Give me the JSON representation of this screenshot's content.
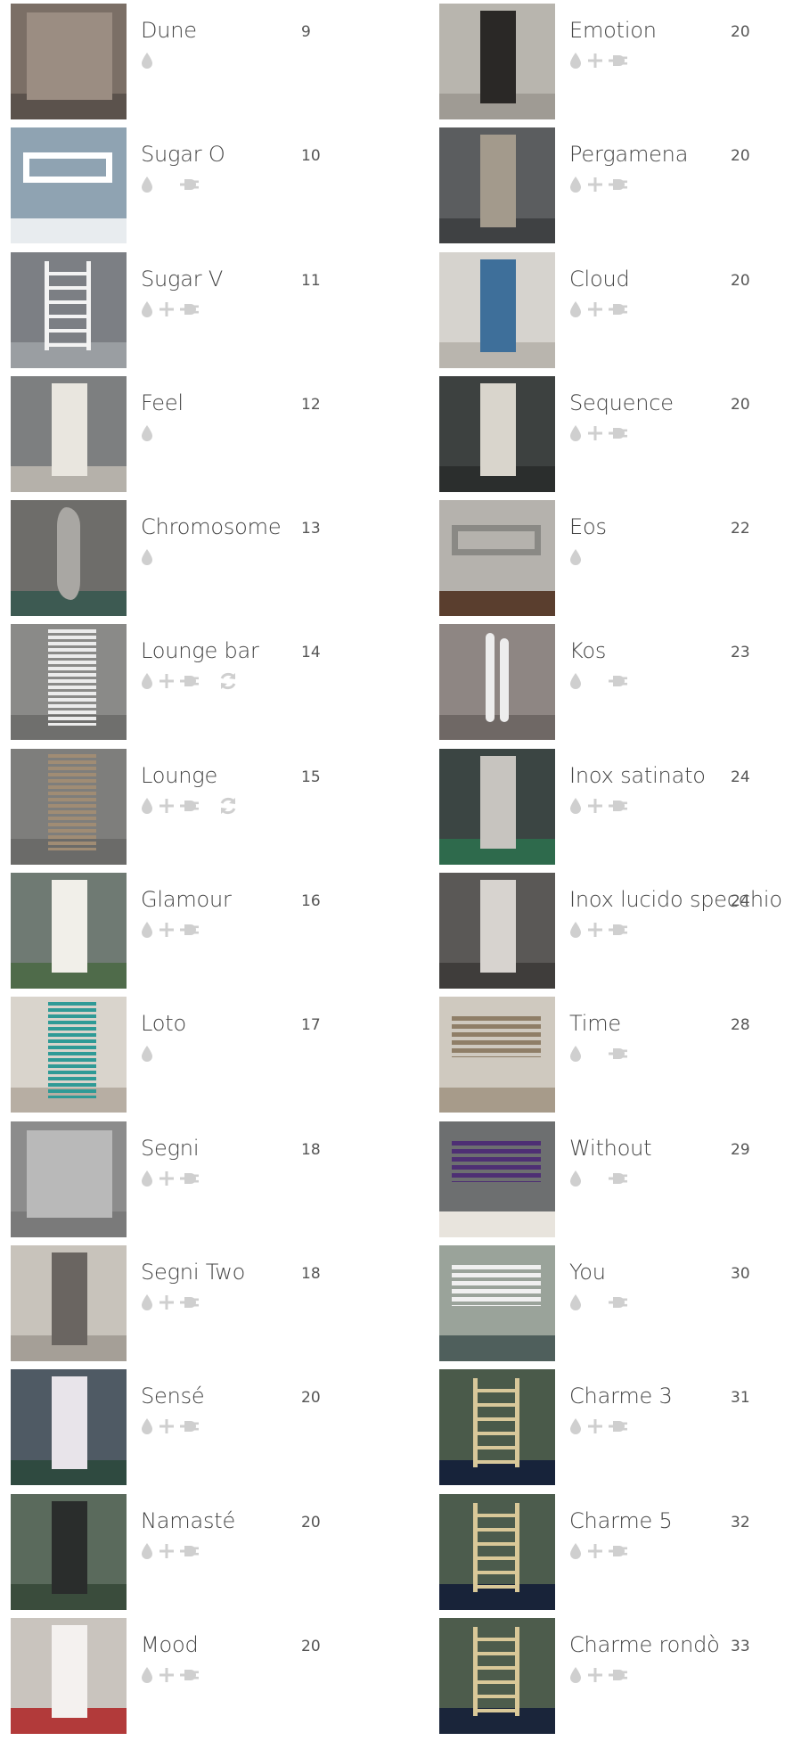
{
  "icon_color": "#cfcfcf",
  "left_column": [
    {
      "name": "Dune",
      "page": "9",
      "icons": [
        "water-drop-icon"
      ],
      "thumb": {
        "wall": "#7b6f66",
        "radiator": "#9b8d82",
        "floor": "#5b524c",
        "shape": "wide-panel"
      }
    },
    {
      "name": "Sugar O",
      "page": "10",
      "icons": [
        "water-drop-icon",
        "electric-plug-icon"
      ],
      "thumb": {
        "wall": "#8fa3b2",
        "radiator": "#ffffff",
        "floor": "#e8ecef",
        "shape": "horizontal-frame"
      }
    },
    {
      "name": "Sugar V",
      "page": "11",
      "icons": [
        "water-drop-icon",
        "plus-icon",
        "electric-plug-icon"
      ],
      "thumb": {
        "wall": "#7c7f84",
        "radiator": "#f3f3f3",
        "floor": "#9a9ea2",
        "shape": "ladder"
      }
    },
    {
      "name": "Feel",
      "page": "12",
      "icons": [
        "water-drop-icon"
      ],
      "thumb": {
        "wall": "#7d7f80",
        "radiator": "#e9e6df",
        "floor": "#b5b1aa",
        "shape": "tall-panel"
      }
    },
    {
      "name": "Chromosome",
      "page": "13",
      "icons": [
        "water-drop-icon"
      ],
      "thumb": {
        "wall": "#6e6d6a",
        "radiator": "#a9a7a3",
        "floor": "#3d5a52",
        "shape": "tall-wavy"
      }
    },
    {
      "name": "Lounge bar",
      "page": "14",
      "icons": [
        "water-drop-icon",
        "plus-icon",
        "electric-plug-icon",
        "rotation-arrows-icon"
      ],
      "thumb": {
        "wall": "#8a8a88",
        "radiator": "#ececec",
        "floor": "#6f6f6d",
        "shape": "tall-grid"
      }
    },
    {
      "name": "Lounge",
      "page": "15",
      "icons": [
        "water-drop-icon",
        "plus-icon",
        "electric-plug-icon",
        "rotation-arrows-icon"
      ],
      "thumb": {
        "wall": "#7e7e7c",
        "radiator": "#a08c74",
        "floor": "#6b6b69",
        "shape": "tall-grid"
      }
    },
    {
      "name": "Glamour",
      "page": "16",
      "icons": [
        "water-drop-icon",
        "plus-icon",
        "electric-plug-icon"
      ],
      "thumb": {
        "wall": "#6f7a73",
        "radiator": "#f1efe9",
        "floor": "#4f6b4a",
        "shape": "tall-panel"
      }
    },
    {
      "name": "Loto",
      "page": "17",
      "icons": [
        "water-drop-icon"
      ],
      "thumb": {
        "wall": "#d9d4cc",
        "radiator": "#2f9a96",
        "floor": "#b7aea3",
        "shape": "tall-grid"
      }
    },
    {
      "name": "Segni",
      "page": "18",
      "icons": [
        "water-drop-icon",
        "plus-icon",
        "electric-plug-icon"
      ],
      "thumb": {
        "wall": "#8c8c8c",
        "radiator": "#b9b9b9",
        "floor": "#7a7a7a",
        "shape": "wide-panel"
      }
    },
    {
      "name": "Segni Two",
      "page": "18",
      "icons": [
        "water-drop-icon",
        "plus-icon",
        "electric-plug-icon"
      ],
      "thumb": {
        "wall": "#c8c3bb",
        "radiator": "#6a6561",
        "floor": "#a59f97",
        "shape": "tall-panel"
      }
    },
    {
      "name": "Sensé",
      "page": "20",
      "icons": [
        "water-drop-icon",
        "plus-icon",
        "electric-plug-icon"
      ],
      "thumb": {
        "wall": "#4f5a64",
        "radiator": "#e8e4ea",
        "floor": "#2f4a40",
        "shape": "tall-panel"
      }
    },
    {
      "name": "Namasté",
      "page": "20",
      "icons": [
        "water-drop-icon",
        "plus-icon",
        "electric-plug-icon"
      ],
      "thumb": {
        "wall": "#5a6a5c",
        "radiator": "#2a2d2c",
        "floor": "#3a4c3c",
        "shape": "tall-panel"
      }
    },
    {
      "name": "Mood",
      "page": "20",
      "icons": [
        "water-drop-icon",
        "plus-icon",
        "electric-plug-icon"
      ],
      "thumb": {
        "wall": "#c9c4be",
        "radiator": "#f4f1ef",
        "floor": "#b23a3a",
        "shape": "tall-panel"
      }
    }
  ],
  "right_column": [
    {
      "name": "Emotion",
      "page": "20",
      "icons": [
        "water-drop-icon",
        "plus-icon",
        "electric-plug-icon"
      ],
      "thumb": {
        "wall": "#b8b5ae",
        "radiator": "#2a2826",
        "floor": "#9f9b94",
        "shape": "tall-panel"
      }
    },
    {
      "name": "Pergamena",
      "page": "20",
      "icons": [
        "water-drop-icon",
        "plus-icon",
        "electric-plug-icon"
      ],
      "thumb": {
        "wall": "#5b5d5f",
        "radiator": "#a39a8c",
        "floor": "#3f4143",
        "shape": "tall-panel"
      }
    },
    {
      "name": "Cloud",
      "page": "20",
      "icons": [
        "water-drop-icon",
        "plus-icon",
        "electric-plug-icon"
      ],
      "thumb": {
        "wall": "#d6d3ce",
        "radiator": "#3e6f9a",
        "floor": "#b9b5ae",
        "shape": "tall-panel"
      }
    },
    {
      "name": "Sequence",
      "page": "20",
      "icons": [
        "water-drop-icon",
        "plus-icon",
        "electric-plug-icon"
      ],
      "thumb": {
        "wall": "#3d4140",
        "radiator": "#d9d5cc",
        "floor": "#2b2e2d",
        "shape": "tall-panel"
      }
    },
    {
      "name": "Eos",
      "page": "22",
      "icons": [
        "water-drop-icon"
      ],
      "thumb": {
        "wall": "#b5b2ad",
        "radiator": "#8a8985",
        "floor": "#5a3e2e",
        "shape": "horizontal-frame"
      }
    },
    {
      "name": "Kos",
      "page": "23",
      "icons": [
        "water-drop-icon",
        "electric-plug-icon"
      ],
      "thumb": {
        "wall": "#8e8683",
        "radiator": "#ededed",
        "floor": "#6f6865",
        "shape": "tall-pipes"
      }
    },
    {
      "name": "Inox satinato",
      "page": "24",
      "icons": [
        "water-drop-icon",
        "plus-icon",
        "electric-plug-icon"
      ],
      "thumb": {
        "wall": "#3b4543",
        "radiator": "#c7c4bf",
        "floor": "#2e6a4c",
        "shape": "tall-panel"
      }
    },
    {
      "name": "Inox lucido specchio",
      "page": "24",
      "icons": [
        "water-drop-icon",
        "plus-icon",
        "electric-plug-icon"
      ],
      "thumb": {
        "wall": "#5a5856",
        "radiator": "#d7d3cf",
        "floor": "#3f3d3b",
        "shape": "tall-panel"
      }
    },
    {
      "name": "Time",
      "page": "28",
      "icons": [
        "water-drop-icon",
        "electric-plug-icon"
      ],
      "thumb": {
        "wall": "#cfc9bf",
        "radiator": "#8f7e67",
        "floor": "#a79b8a",
        "shape": "horizontal-bars"
      }
    },
    {
      "name": "Without",
      "page": "29",
      "icons": [
        "water-drop-icon",
        "electric-plug-icon"
      ],
      "thumb": {
        "wall": "#6d6f70",
        "radiator": "#4e2f74",
        "floor": "#e8e4dd",
        "shape": "horizontal-bars"
      }
    },
    {
      "name": "You",
      "page": "30",
      "icons": [
        "water-drop-icon",
        "electric-plug-icon"
      ],
      "thumb": {
        "wall": "#9aa39a",
        "radiator": "#f0f0f0",
        "floor": "#4f5f5c",
        "shape": "horizontal-bars"
      }
    },
    {
      "name": "Charme 3",
      "page": "31",
      "icons": [
        "water-drop-icon",
        "plus-icon",
        "electric-plug-icon"
      ],
      "thumb": {
        "wall": "#4a5a4a",
        "radiator": "#d8c89a",
        "floor": "#17233a",
        "shape": "ladder"
      }
    },
    {
      "name": "Charme 5",
      "page": "32",
      "icons": [
        "water-drop-icon",
        "plus-icon",
        "electric-plug-icon"
      ],
      "thumb": {
        "wall": "#4c5c4d",
        "radiator": "#d9c898",
        "floor": "#182339",
        "shape": "ladder"
      }
    },
    {
      "name": "Charme rondò",
      "page": "33",
      "icons": [
        "water-drop-icon",
        "plus-icon",
        "electric-plug-icon"
      ],
      "thumb": {
        "wall": "#4d5c4c",
        "radiator": "#d9c898",
        "floor": "#1a253a",
        "shape": "ladder"
      }
    }
  ]
}
